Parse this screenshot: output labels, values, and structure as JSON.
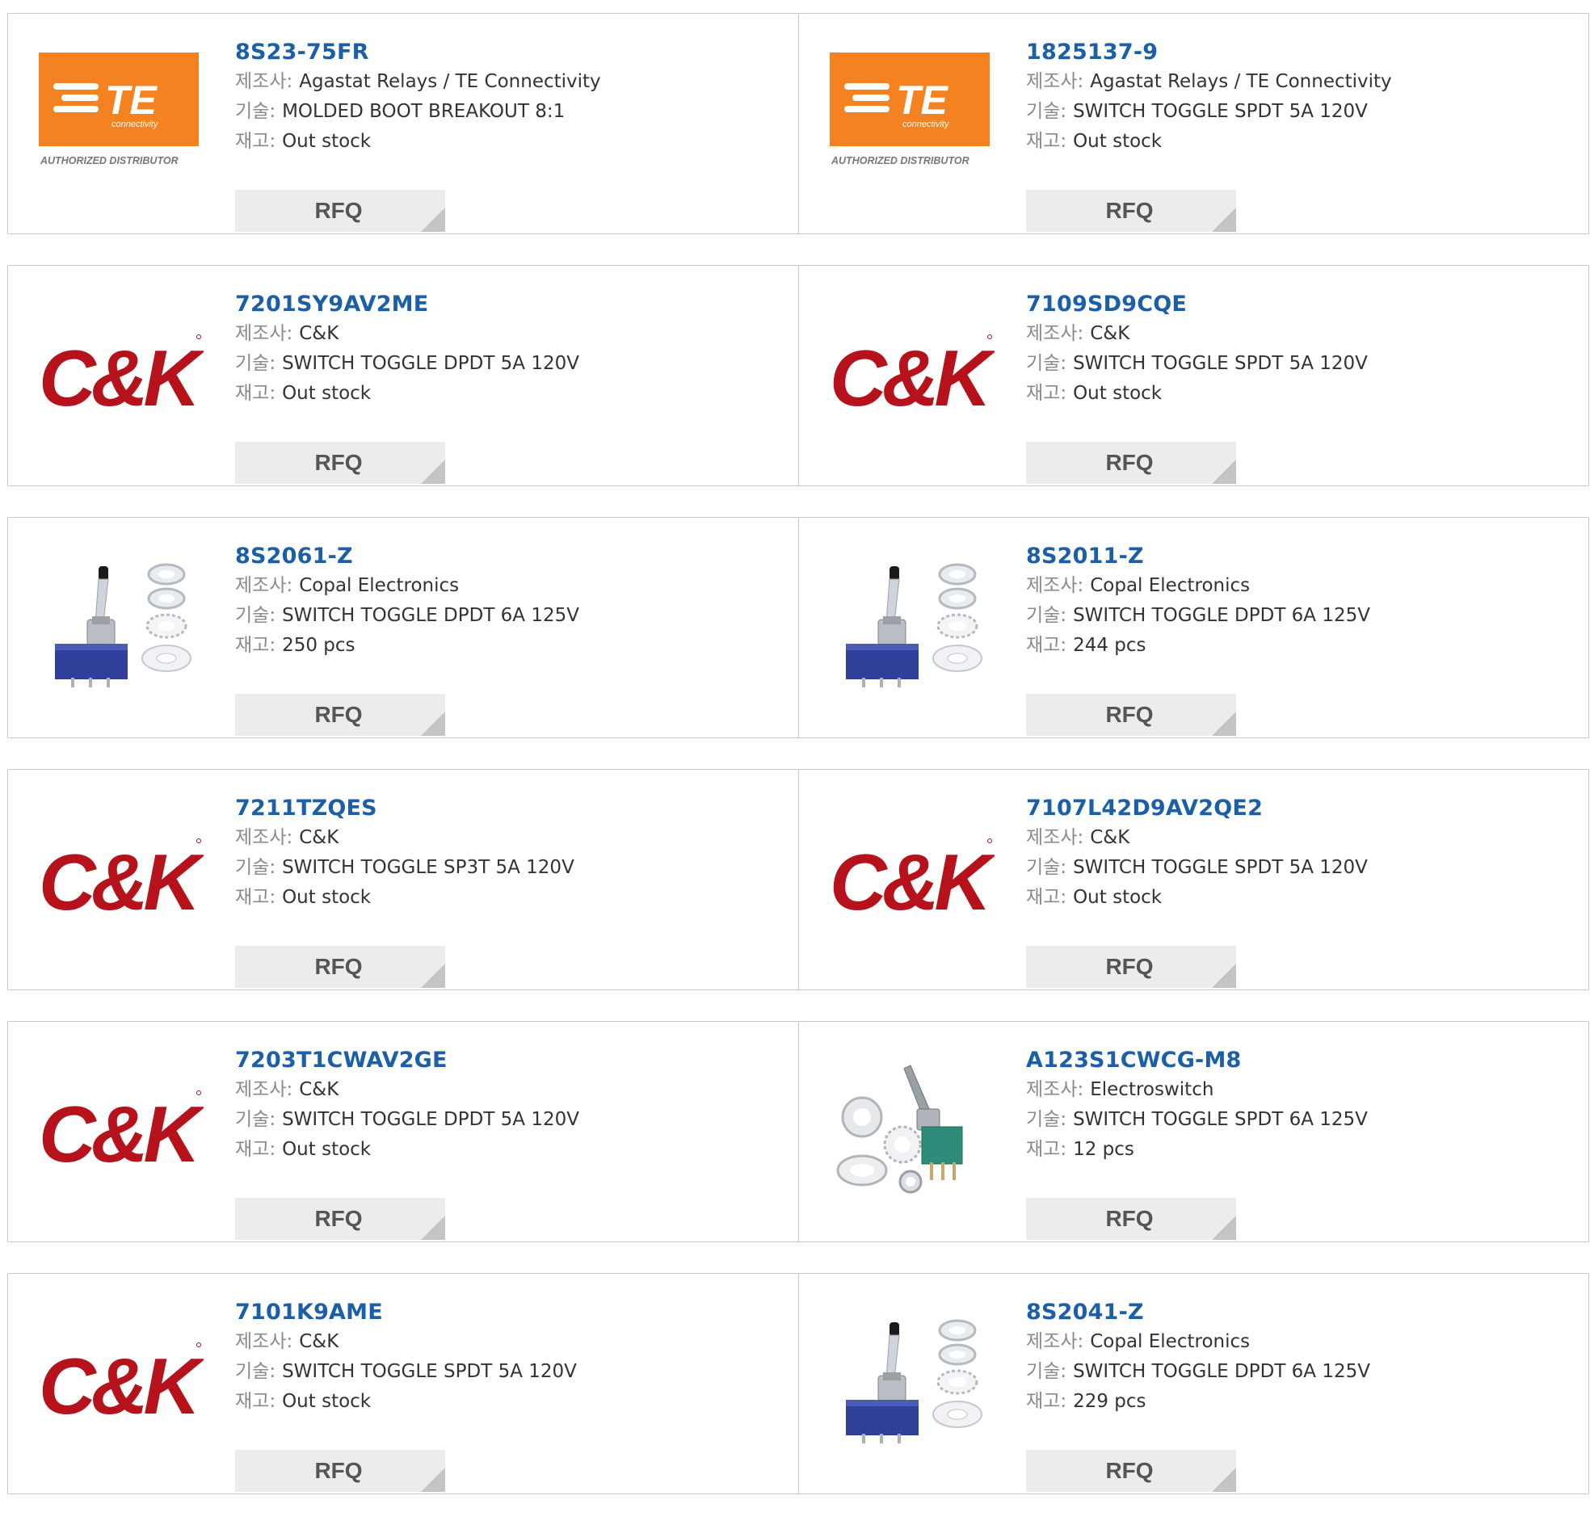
{
  "labels": {
    "manufacturer": "제조사:",
    "description": "기술:",
    "stock": "재고:",
    "rfq": "RFQ"
  },
  "logos": {
    "te_text": "TE",
    "te_sub": "connectivity",
    "te_auth": "AUTHORIZED DISTRIBUTOR",
    "ck_text": "C&K",
    "te_color": "#f58220",
    "ck_color": "#b5121b"
  },
  "products": [
    {
      "part": "8S23-75FR",
      "manufacturer": "Agastat Relays / TE Connectivity",
      "description": "MOLDED BOOT BREAKOUT 8:1",
      "stock": "Out stock",
      "image": "te-logo"
    },
    {
      "part": "1825137-9",
      "manufacturer": "Agastat Relays / TE Connectivity",
      "description": "SWITCH TOGGLE SPDT 5A 120V",
      "stock": "Out stock",
      "image": "te-logo"
    },
    {
      "part": "7201SY9AV2ME",
      "manufacturer": "C&K",
      "description": "SWITCH TOGGLE DPDT 5A 120V",
      "stock": "Out stock",
      "image": "ck-logo"
    },
    {
      "part": "7109SD9CQE",
      "manufacturer": "C&K",
      "description": "SWITCH TOGGLE SPDT 5A 120V",
      "stock": "Out stock",
      "image": "ck-logo"
    },
    {
      "part": "8S2061-Z",
      "manufacturer": "Copal Electronics",
      "description": "SWITCH TOGGLE DPDT 6A 125V",
      "stock": "250 pcs",
      "image": "toggle-switch-blue"
    },
    {
      "part": "8S2011-Z",
      "manufacturer": "Copal Electronics",
      "description": "SWITCH TOGGLE DPDT 6A 125V",
      "stock": "244 pcs",
      "image": "toggle-switch-blue"
    },
    {
      "part": "7211TZQES",
      "manufacturer": "C&K",
      "description": "SWITCH TOGGLE SP3T 5A 120V",
      "stock": "Out stock",
      "image": "ck-logo"
    },
    {
      "part": "7107L42D9AV2QE2",
      "manufacturer": "C&K",
      "description": "SWITCH TOGGLE SPDT 5A 120V",
      "stock": "Out stock",
      "image": "ck-logo"
    },
    {
      "part": "7203T1CWAV2GE",
      "manufacturer": "C&K",
      "description": "SWITCH TOGGLE DPDT 5A 120V",
      "stock": "Out stock",
      "image": "ck-logo"
    },
    {
      "part": "A123S1CWCG-M8",
      "manufacturer": "Electroswitch",
      "description": "SWITCH TOGGLE SPDT 6A 125V",
      "stock": "12 pcs",
      "image": "toggle-switch-green"
    },
    {
      "part": "7101K9AME",
      "manufacturer": "C&K",
      "description": "SWITCH TOGGLE SPDT 5A 120V",
      "stock": "Out stock",
      "image": "ck-logo"
    },
    {
      "part": "8S2041-Z",
      "manufacturer": "Copal Electronics",
      "description": "SWITCH TOGGLE DPDT 6A 125V",
      "stock": "229 pcs",
      "image": "toggle-switch-blue"
    }
  ]
}
